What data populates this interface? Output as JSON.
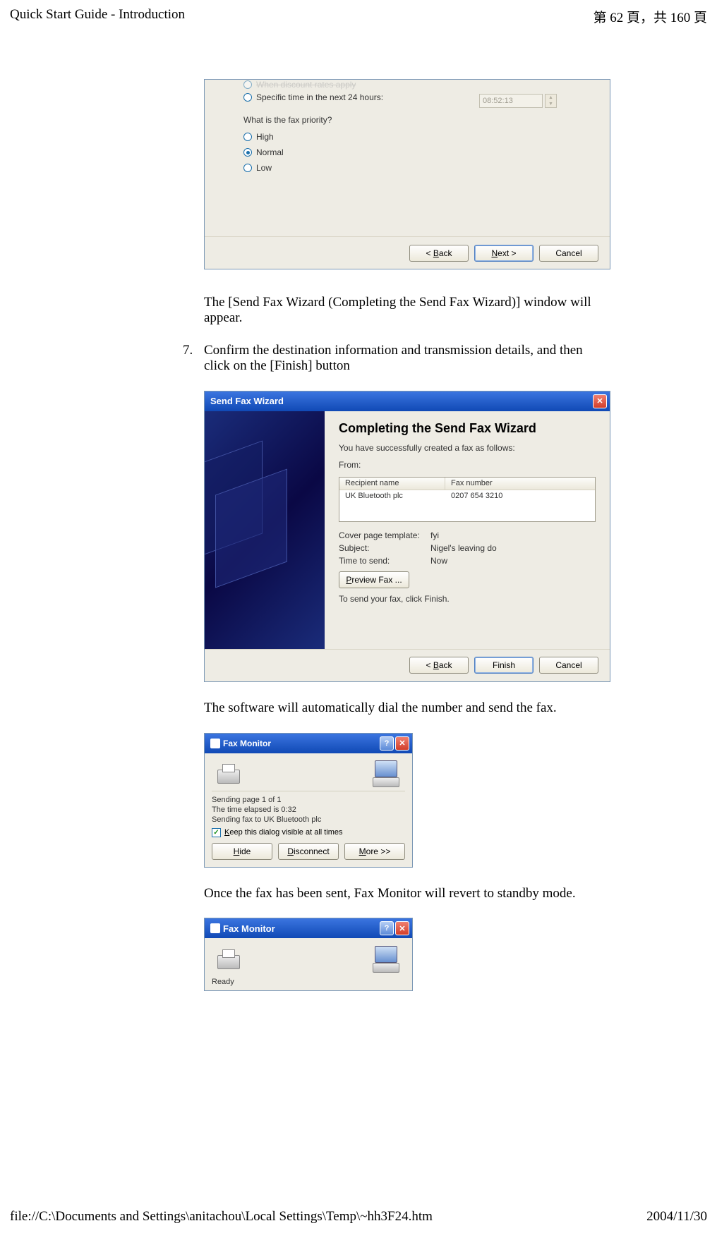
{
  "header": {
    "title": "Quick Start Guide - Introduction",
    "page_info": "第 62 頁，共 160 頁"
  },
  "footer": {
    "path": "file://C:\\Documents and Settings\\anitachou\\Local Settings\\Temp\\~hh3F24.htm",
    "date": "2004/11/30"
  },
  "dlg1": {
    "opt_discount": "When discount rates apply",
    "opt_specific": "Specific time in the next 24 hours:",
    "time_value": "08:52:13",
    "question2": "What is the fax priority?",
    "opt_high": "High",
    "opt_normal": "Normal",
    "opt_low": "Low",
    "btn_back": "< Back",
    "btn_next": "Next >",
    "btn_cancel": "Cancel"
  },
  "text": {
    "t1": "The [Send Fax Wizard (Completing the Send Fax Wizard)] window will appear.",
    "step7_num": "7.",
    "step7": "Confirm the destination information and transmission details, and then click on the [Finish] button",
    "t2": "The software will automatically dial the number and send the fax.",
    "t3": "Once the fax has been sent, Fax Monitor will revert to standby mode."
  },
  "dlg2": {
    "title": "Send Fax Wizard",
    "heading": "Completing the Send Fax Wizard",
    "sub": "You have successfully created a fax as follows:",
    "from_label": "From:",
    "col_recipient": "Recipient name",
    "col_faxnum": "Fax number",
    "row_recipient": "UK Bluetooth plc",
    "row_faxnum": "0207 654 3210",
    "cover_k": "Cover page template:",
    "cover_v": "fyi",
    "subject_k": "Subject:",
    "subject_v": "Nigel's leaving do",
    "time_k": "Time to send:",
    "time_v": "Now",
    "preview_btn": "Preview Fax ...",
    "footer_text": "To send your fax, click Finish.",
    "btn_back": "< Back",
    "btn_finish": "Finish",
    "btn_cancel": "Cancel"
  },
  "dlg3": {
    "title": "Fax Monitor",
    "line1": "Sending page 1 of 1",
    "line2": "The time elapsed is 0:32",
    "line3": "Sending fax to UK Bluetooth plc",
    "check_label": "Keep this dialog visible at all times",
    "btn_hide": "Hide",
    "btn_disconnect": "Disconnect",
    "btn_more": "More >>"
  },
  "dlg4": {
    "title": "Fax Monitor",
    "status": "Ready"
  }
}
